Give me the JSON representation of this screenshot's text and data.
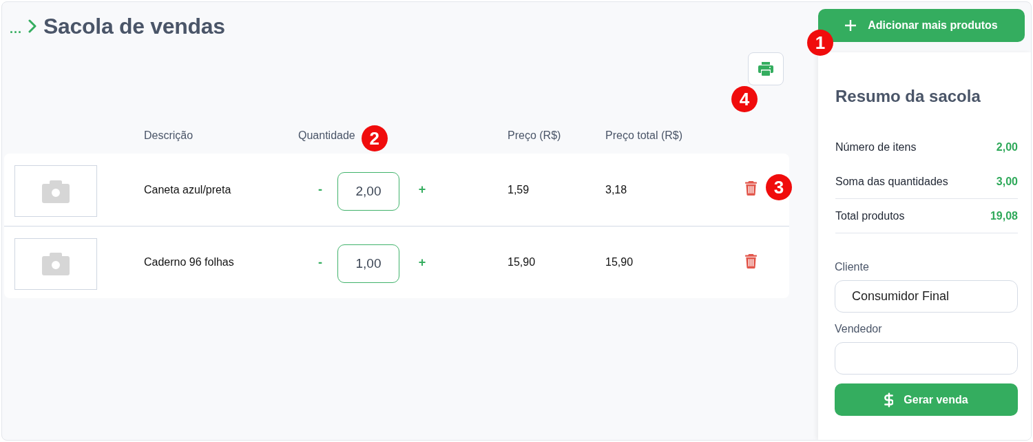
{
  "breadcrumb": {
    "ellipsis": "...",
    "title": "Sacola de vendas"
  },
  "add_button": {
    "label": "Adicionar mais produtos",
    "callout": "1"
  },
  "print_button": {
    "callout": "4"
  },
  "table": {
    "columns": [
      {
        "label": "Descrição"
      },
      {
        "label": "Quantidade",
        "callout": "2"
      },
      {
        "label": "Preço (R$)"
      },
      {
        "label": "Preço total (R$)"
      }
    ],
    "rows": [
      {
        "description": "Caneta azul/preta",
        "decrement": "-",
        "quantity": "2,00",
        "increment": "+",
        "price": "1,59",
        "total": "3,18",
        "callout": "3"
      },
      {
        "description": "Caderno 96 folhas",
        "decrement": "-",
        "quantity": "1,00",
        "increment": "+",
        "price": "15,90",
        "total": "15,90"
      }
    ]
  },
  "summary": {
    "title": "Resumo da sacola",
    "lines": [
      {
        "label": "Número de itens",
        "value": "2,00"
      },
      {
        "label": "Soma das quantidades",
        "value": "3,00"
      },
      {
        "label": "Total produtos",
        "value": "19,08"
      }
    ],
    "fields": [
      {
        "label": "Cliente",
        "value": "Consumidor Final"
      },
      {
        "label": "Vendedor"
      }
    ],
    "submit_button": {
      "label": "Gerar venda"
    }
  }
}
